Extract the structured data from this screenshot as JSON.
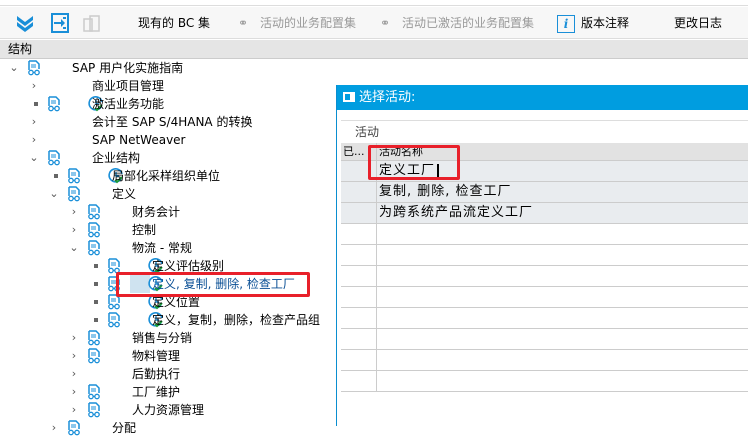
{
  "toolbar": {
    "items": [
      {
        "label": "现有的 BC 集",
        "enabled": true
      },
      {
        "label": "活动的业务配置集",
        "enabled": false
      },
      {
        "label": "活动已激活的业务配置集",
        "enabled": false
      },
      {
        "label": "版本注释",
        "enabled": true
      },
      {
        "label": "更改日志",
        "enabled": true
      }
    ]
  },
  "structure": {
    "header": "结构",
    "tree": [
      {
        "label": "SAP 用户化实施指南",
        "level": 0,
        "toggle": "expanded",
        "book": true,
        "clock": false
      },
      {
        "label": "商业项目管理",
        "level": 1,
        "toggle": "collapsed",
        "book": false,
        "clock": false
      },
      {
        "label": "激活业务功能",
        "level": 1,
        "toggle": "leaf",
        "book": true,
        "clock": true
      },
      {
        "label": "会计至 SAP S/4HANA 的转换",
        "level": 1,
        "toggle": "collapsed",
        "book": false,
        "clock": false
      },
      {
        "label": "SAP NetWeaver",
        "level": 1,
        "toggle": "collapsed",
        "book": false,
        "clock": false
      },
      {
        "label": "企业结构",
        "level": 1,
        "toggle": "expanded",
        "book": true,
        "clock": false
      },
      {
        "label": "局部化采样组织单位",
        "level": 2,
        "toggle": "leaf",
        "book": true,
        "clock": true
      },
      {
        "label": "定义",
        "level": 2,
        "toggle": "expanded",
        "book": true,
        "clock": false
      },
      {
        "label": "财务会计",
        "level": 3,
        "toggle": "collapsed",
        "book": true,
        "clock": false
      },
      {
        "label": "控制",
        "level": 3,
        "toggle": "collapsed",
        "book": true,
        "clock": false
      },
      {
        "label": "物流 - 常规",
        "level": 3,
        "toggle": "expanded",
        "book": true,
        "clock": false
      },
      {
        "label": "定义评估级别",
        "level": 4,
        "toggle": "leaf",
        "book": true,
        "clock": true
      },
      {
        "label": "定义, 复制, 删除, 检查工厂",
        "level": 4,
        "toggle": "leaf",
        "book": true,
        "clock": true,
        "selected": true
      },
      {
        "label": "定义位置",
        "level": 4,
        "toggle": "leaf",
        "book": true,
        "clock": true
      },
      {
        "label": "定义，复制，删除，检查产品组",
        "level": 4,
        "toggle": "leaf",
        "book": true,
        "clock": true
      },
      {
        "label": "销售与分销",
        "level": 3,
        "toggle": "collapsed",
        "book": true,
        "clock": false
      },
      {
        "label": "物料管理",
        "level": 3,
        "toggle": "collapsed",
        "book": true,
        "clock": false
      },
      {
        "label": "后勤执行",
        "level": 3,
        "toggle": "collapsed",
        "book": false,
        "clock": false
      },
      {
        "label": "工厂维护",
        "level": 3,
        "toggle": "collapsed",
        "book": true,
        "clock": false
      },
      {
        "label": "人力资源管理",
        "level": 3,
        "toggle": "collapsed",
        "book": true,
        "clock": false
      },
      {
        "label": "分配",
        "level": 2,
        "toggle": "collapsed",
        "book": true,
        "clock": false
      }
    ]
  },
  "popup": {
    "title": "选择活动:",
    "section": "活动",
    "columns": [
      "已...",
      "活动名称"
    ],
    "rows": [
      {
        "status": "",
        "name": "定义工厂"
      },
      {
        "status": "",
        "name": "复制, 删除, 检查工厂"
      },
      {
        "status": "",
        "name": "为跨系统产品流定义工厂"
      }
    ]
  },
  "colors": {
    "accent": "#009de0",
    "highlight": "#e8202a",
    "selected_text": "#0a4f95"
  }
}
